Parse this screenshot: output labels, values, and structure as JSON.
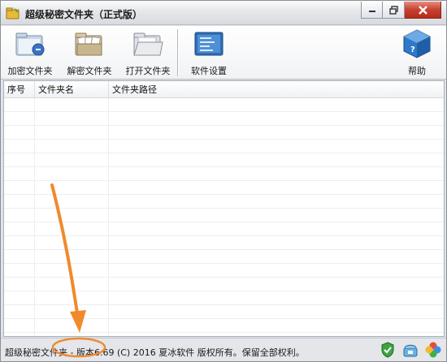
{
  "window": {
    "title": "超级秘密文件夹（正式版）"
  },
  "toolbar": {
    "items": [
      {
        "label": "加密文件夹",
        "icon": "folder-lock-icon"
      },
      {
        "label": "解密文件夹",
        "icon": "folder-unlock-icon"
      },
      {
        "label": "打开文件夹",
        "icon": "folder-open-icon"
      },
      {
        "label": "软件设置",
        "icon": "settings-icon"
      },
      {
        "label": "帮助",
        "icon": "help-cube-icon"
      }
    ]
  },
  "table": {
    "columns": [
      "序号",
      "文件夹名",
      "文件夹路径"
    ],
    "rows": []
  },
  "status": {
    "text": "超级秘密文件夹 - 版本6.69 (C) 2016 夏冰软件 版权所有。保留全部权利。"
  },
  "colors": {
    "annotation": "#f08a2c",
    "close_button": "#c7412f"
  }
}
